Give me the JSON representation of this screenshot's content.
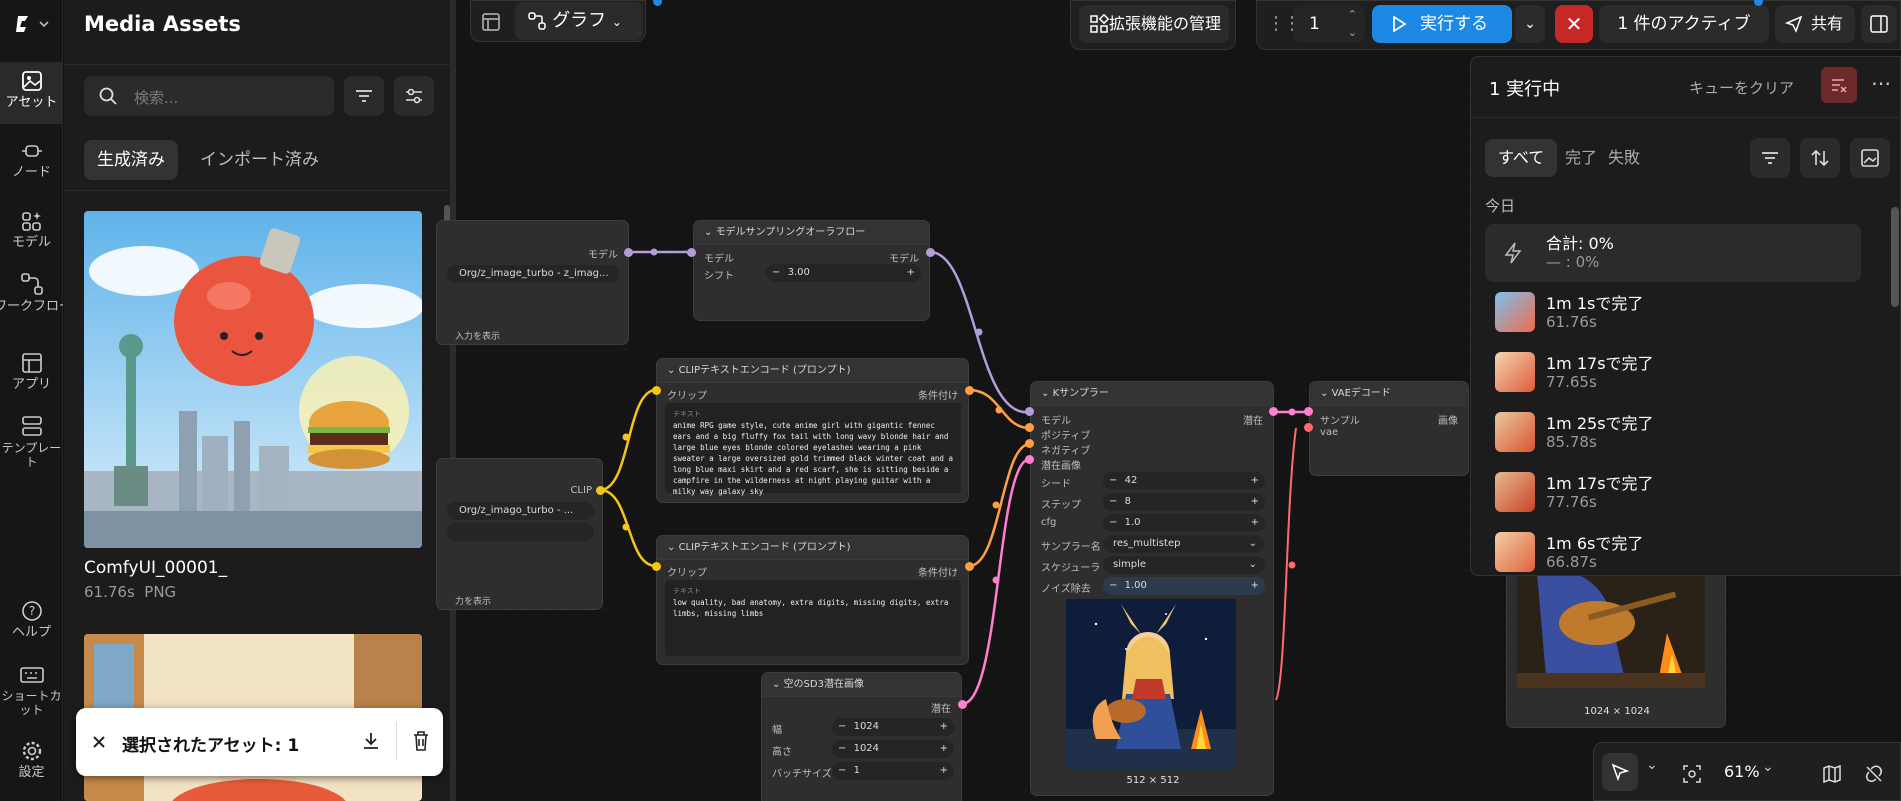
{
  "rail": {
    "items": [
      {
        "label": "アセット",
        "icon": "image-icon"
      },
      {
        "label": "ノード",
        "icon": "node-icon"
      },
      {
        "label": "モデル",
        "icon": "model-icon"
      },
      {
        "label": "ワークフロー",
        "icon": "workflow-icon"
      },
      {
        "label": "アプリ",
        "icon": "app-icon"
      },
      {
        "label": "テンプレート",
        "icon": "template-icon"
      }
    ],
    "help": "ヘルプ",
    "shortcuts": "ショートカット",
    "settings": "設定"
  },
  "assets": {
    "title": "Media Assets",
    "search_placeholder": "検索...",
    "tabs": [
      "生成済み",
      "インポート済み"
    ],
    "items": [
      {
        "name": "ComfyUI_00001_",
        "meta": "61.76s  PNG"
      }
    ],
    "selection_text": "選択されたアセット: 1"
  },
  "toolbar": {
    "graph_label": "グラフ",
    "extensions_label": "拡張機能の管理",
    "run_count": "1",
    "run_label": "実行する",
    "active_label": "1 件のアクティブ",
    "share_label": "共有"
  },
  "queue": {
    "title": "1 実行中",
    "clear_label": "キューをクリア",
    "filters": [
      "すべて",
      "完了",
      "失敗"
    ],
    "section": "今日",
    "total_title": "合計: 0%",
    "total_sub": "— : 0%",
    "items": [
      {
        "title": "1m 1sで完了",
        "sub": "61.76s"
      },
      {
        "title": "1m 17sで完了",
        "sub": "77.65s"
      },
      {
        "title": "1m 25sで完了",
        "sub": "85.78s"
      },
      {
        "title": "1m 17sで完了",
        "sub": "77.76s"
      },
      {
        "title": "1m 6sで完了",
        "sub": "66.87s"
      }
    ]
  },
  "nodes": {
    "loader1": {
      "out": "モデル",
      "value": "Org/z_image_turbo - z_imag...",
      "show_input": "入力を表示"
    },
    "loader2": {
      "out": "CLIP",
      "value": "Org/z_imago_turbo - ...",
      "show_input": "力を表示"
    },
    "aura": {
      "title": "モデルサンプリングオーラフロー",
      "in": "モデル",
      "out": "モデル",
      "shift_label": "シフト",
      "shift_value": "3.00"
    },
    "clip_pos": {
      "title": "CLIPテキストエンコード (プロンプト)",
      "in": "クリップ",
      "out": "条件付け",
      "text_label": "テキスト",
      "text": "anime RPG game style, cute anime girl with gigantic fennec ears and a big fluffy fox tail with long wavy blonde hair and large blue eyes blonde colored eyelashes wearing a pink sweater a large oversized gold trimmed black winter coat and a long blue maxi skirt and a red scarf, she is sitting beside a campfire in the wilderness at night playing guitar with a milky way galaxy sky"
    },
    "clip_neg": {
      "title": "CLIPテキストエンコード (プロンプト)",
      "in": "クリップ",
      "out": "条件付け",
      "text_label": "テキスト",
      "text": "low quality, bad anatomy, extra digits, missing digits, extra limbs, missing limbs"
    },
    "latent": {
      "title": "空のSD3潜在画像",
      "out": "潜在",
      "rows": [
        {
          "label": "幅",
          "value": "1024"
        },
        {
          "label": "高さ",
          "value": "1024"
        },
        {
          "label": "バッチサイズ",
          "value": "1"
        }
      ]
    },
    "ksampler": {
      "title": "Kサンプラー",
      "inputs": [
        "モデル",
        "ポジティブ",
        "ネガティブ",
        "潜在画像"
      ],
      "out": "潜在",
      "rows": [
        {
          "label": "シード",
          "value": "42"
        },
        {
          "label": "ステップ",
          "value": "8"
        },
        {
          "label": "cfg",
          "value": "1.0"
        },
        {
          "label": "サンプラー名",
          "value": "res_multistep"
        },
        {
          "label": "スケジューラ",
          "value": "simple"
        },
        {
          "label": "ノイズ除去",
          "value": "1.00"
        }
      ],
      "preview_size": "512 × 512"
    },
    "vae": {
      "title": "VAEデコード",
      "in1": "サンプル",
      "in2": "vae",
      "out": "画像"
    },
    "output": {
      "size": "1024 × 1024"
    }
  },
  "bottom": {
    "zoom": "61%"
  },
  "colors": {
    "accent": "#1e88e5",
    "danger": "#c62828",
    "clip": "#f5c518",
    "model": "#b39ddb",
    "cond": "#ff9f43",
    "latent": "#ff7fd0",
    "vae": "#ff6b6b"
  }
}
